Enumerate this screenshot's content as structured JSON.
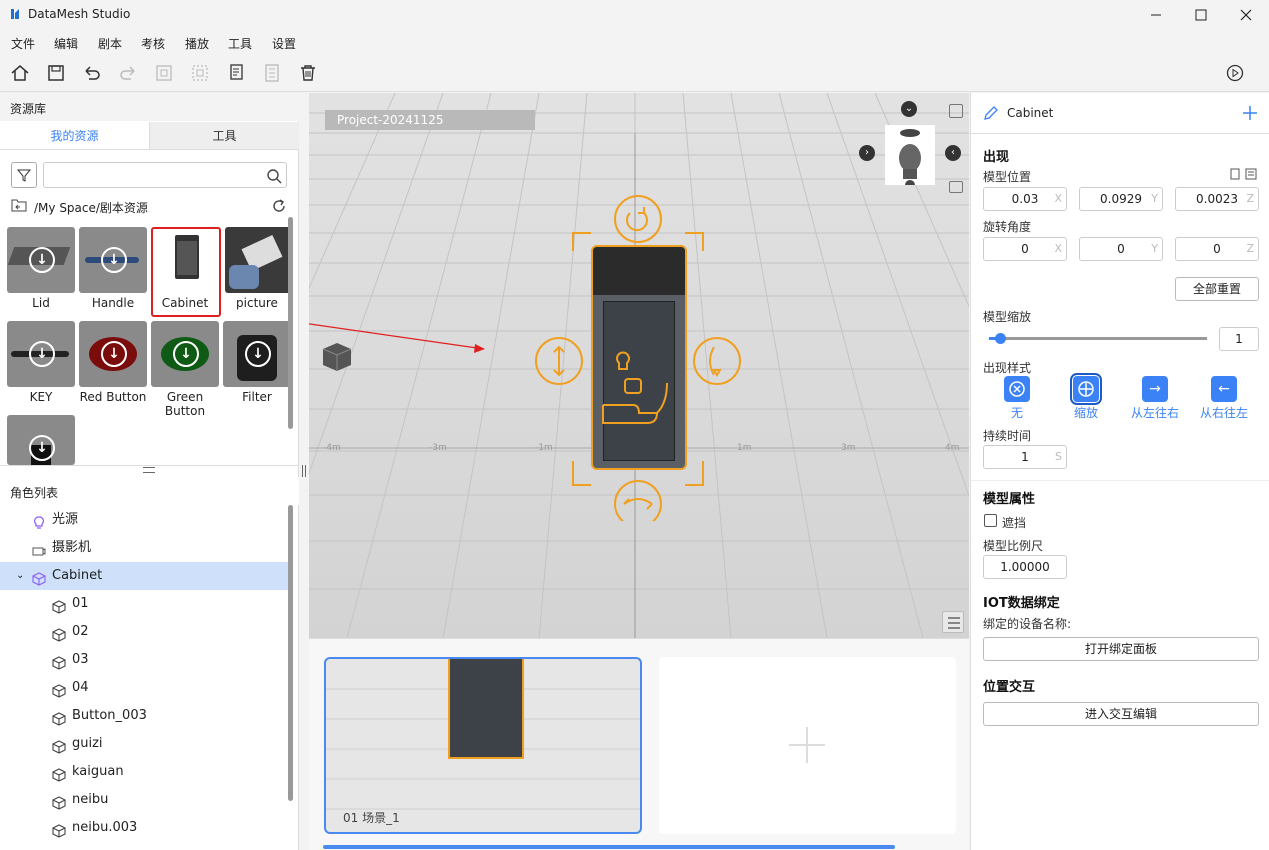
{
  "app": {
    "title": "DataMesh Studio"
  },
  "menu": [
    "文件",
    "编辑",
    "剧本",
    "考核",
    "播放",
    "工具",
    "设置"
  ],
  "left": {
    "library_title": "资源库",
    "tabs": [
      "我的资源",
      "工具"
    ],
    "search_placeholder": "",
    "path": "/My Space/剧本资源",
    "assets": [
      {
        "label": "Lid",
        "color": "#7c7c7c"
      },
      {
        "label": "Handle",
        "color": "#7c7c7c"
      },
      {
        "label": "Cabinet",
        "color": "#ffffff"
      },
      {
        "label": "picture",
        "color": "#444444"
      },
      {
        "label": "KEY",
        "color": "#7c7c7c"
      },
      {
        "label": "Red Button",
        "color": "#7c7c7c"
      },
      {
        "label": "Green Button",
        "color": "#7c7c7c"
      },
      {
        "label": "Filter",
        "color": "#7c7c7c"
      }
    ],
    "roles_title": "角色列表",
    "tree": [
      {
        "label": "光源",
        "icon": "bulb-icon",
        "indent": 1
      },
      {
        "label": "摄影机",
        "icon": "camera-icon",
        "indent": 1
      },
      {
        "label": "Cabinet",
        "icon": "cube-icon",
        "indent": 0,
        "selected": true
      },
      {
        "label": "01",
        "icon": "cube-icon",
        "indent": 2
      },
      {
        "label": "02",
        "icon": "cube-icon",
        "indent": 2
      },
      {
        "label": "03",
        "icon": "cube-icon",
        "indent": 2
      },
      {
        "label": "04",
        "icon": "cube-icon",
        "indent": 2
      },
      {
        "label": "Button_003",
        "icon": "cube-icon",
        "indent": 2
      },
      {
        "label": "guizi",
        "icon": "cube-icon",
        "indent": 2
      },
      {
        "label": "kaiguan",
        "icon": "cube-icon",
        "indent": 2
      },
      {
        "label": "neibu",
        "icon": "cube-icon",
        "indent": 2
      },
      {
        "label": "neibu.003",
        "icon": "cube-icon",
        "indent": 2
      }
    ]
  },
  "viewport": {
    "project": "Project-20241125",
    "ruler": [
      "-4m",
      "-3m",
      "-1m",
      "1m",
      "3m",
      "4m",
      "5m"
    ]
  },
  "timeline": {
    "scene_label": "01 场景_1"
  },
  "right": {
    "object_name": "Cabinet",
    "appear": "出现",
    "pos_label": "模型位置",
    "pos": {
      "x": "0.03",
      "y": "0.0929",
      "z": "0.0023"
    },
    "rot_label": "旋转角度",
    "rot": {
      "x": "0",
      "y": "0",
      "z": "0"
    },
    "reset_all": "全部重置",
    "scale_label": "模型缩放",
    "scale_value": "1",
    "scale_level": 0.05,
    "style_label": "出现样式",
    "styles": [
      {
        "label": "无",
        "icon": "close-circle-icon"
      },
      {
        "label": "缩放",
        "icon": "scale-icon",
        "selected": true
      },
      {
        "label": "从左往右",
        "icon": "arrow-right-icon"
      },
      {
        "label": "从右往左",
        "icon": "arrow-left-icon"
      }
    ],
    "duration_label": "持续时间",
    "duration_value": "1",
    "duration_unit": "S",
    "model_props": "模型属性",
    "occlude": "遮挡",
    "scale_ruler_label": "模型比例尺",
    "scale_ruler_value": "1.00000",
    "iot_title": "IOT数据绑定",
    "iot_device": "绑定的设备名称:",
    "iot_button": "打开绑定面板",
    "interact_title": "位置交互",
    "interact_button": "进入交互编辑"
  }
}
